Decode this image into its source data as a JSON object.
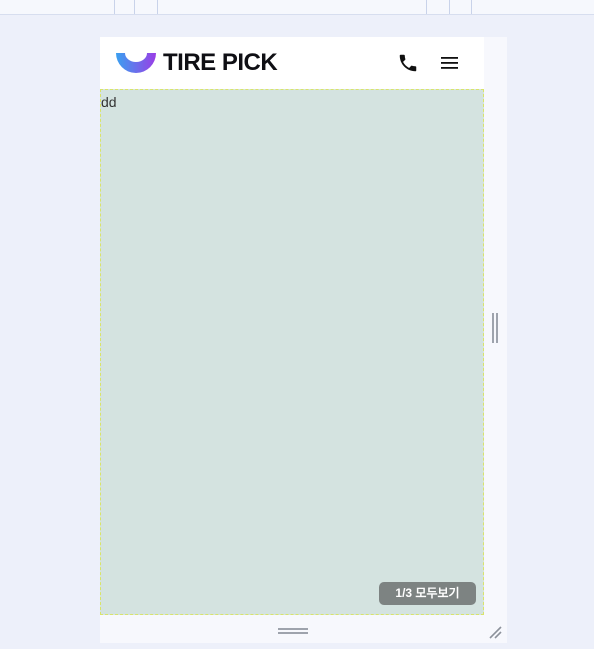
{
  "site": {
    "logo_text": "TIRE PICK",
    "content_text": "dd",
    "view_all_label": "1/3 모두보기"
  },
  "icons": {
    "logo": "logo-mark-icon",
    "phone": "phone-icon",
    "menu": "hamburger-menu-icon",
    "resize_horizontal": "resize-handle-icon",
    "resize_vertical": "resize-handle-icon",
    "resize_corner": "resize-corner-icon"
  },
  "colors": {
    "canvas_bg": "#edf0fa",
    "content_bg": "#d4e3e0",
    "content_border": "#d9e46a",
    "logo_gradient_start": "#3aa0f0",
    "logo_gradient_end": "#9a3ee6",
    "button_bg": "#7d8382"
  }
}
